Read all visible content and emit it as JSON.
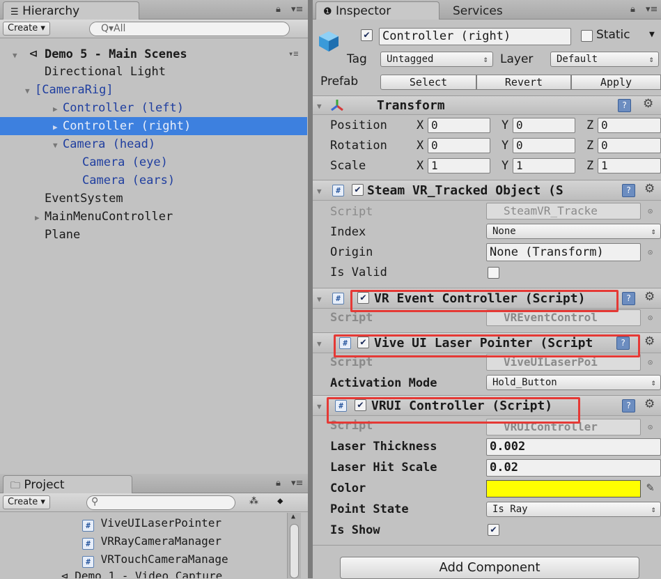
{
  "hierarchy": {
    "tab_label": "Hierarchy",
    "create_label": "Create ▾",
    "search_placeholder": "Q▾All",
    "scene_name": "Demo 5 -  Main Scenes",
    "items": [
      {
        "label": "Directional Light"
      },
      {
        "label": "[CameraRig]"
      },
      {
        "label": "Controller (left)"
      },
      {
        "label": "Controller (right)"
      },
      {
        "label": "Camera (head)"
      },
      {
        "label": "Camera (eye)"
      },
      {
        "label": "Camera (ears)"
      },
      {
        "label": "EventSystem"
      },
      {
        "label": "MainMenuController"
      },
      {
        "label": "Plane"
      }
    ]
  },
  "project": {
    "tab_label": "Project",
    "create_label": "Create ▾",
    "items": [
      {
        "label": "ViveUILaserPointer"
      },
      {
        "label": "VRRayCameraManager"
      },
      {
        "label": "VRTouchCameraManage"
      },
      {
        "label": "Demo 1 - Video Capture"
      }
    ]
  },
  "inspector": {
    "tab_label": "Inspector",
    "services_tab_label": "Services",
    "object_name": "Controller (right)",
    "static_label": "Static",
    "tag_label": "Tag",
    "tag_value": "Untagged",
    "layer_label": "Layer",
    "layer_value": "Default",
    "prefab_label": "Prefab",
    "prefab_select": "Select",
    "prefab_revert": "Revert",
    "prefab_apply": "Apply",
    "transform": {
      "title": "Transform",
      "position_label": "Position",
      "rotation_label": "Rotation",
      "scale_label": "Scale",
      "x_label": "X",
      "y_label": "Y",
      "z_label": "Z",
      "position": [
        "0",
        "0",
        "0"
      ],
      "rotation": [
        "0",
        "0",
        "0"
      ],
      "scale": [
        "1",
        "1",
        "1"
      ]
    },
    "tracked": {
      "title": "Steam VR_Tracked Object (S",
      "script_label": "Script",
      "script_value": "SteamVR_Tracke",
      "index_label": "Index",
      "index_value": "None",
      "origin_label": "Origin",
      "origin_value": "None (Transform)",
      "isvalid_label": "Is Valid"
    },
    "event_controller": {
      "title": "VR Event Controller (Script)",
      "script_label": "Script",
      "script_value": "VREventControl"
    },
    "laser_pointer": {
      "title": "Vive UI Laser Pointer (Script",
      "script_label": "Script",
      "script_value": "ViveUILaserPoi",
      "activation_label": "Activation Mode",
      "activation_value": "Hold_Button"
    },
    "vrui": {
      "title": "VRUI Controller (Script)",
      "script_label": "Script",
      "script_value": "VRUIController",
      "thickness_label": "Laser Thickness",
      "thickness_value": "0.002",
      "hitscale_label": "Laser Hit Scale",
      "hitscale_value": "0.02",
      "color_label": "Color",
      "color_value": "#ffff00",
      "pointstate_label": "Point State",
      "pointstate_value": "Is Ray",
      "isshow_label": "Is Show"
    },
    "add_component": "Add Component"
  },
  "colors": {
    "selection": "#3d80df",
    "highlight_box": "#e53935",
    "prefab_text": "#1f3e9f"
  }
}
